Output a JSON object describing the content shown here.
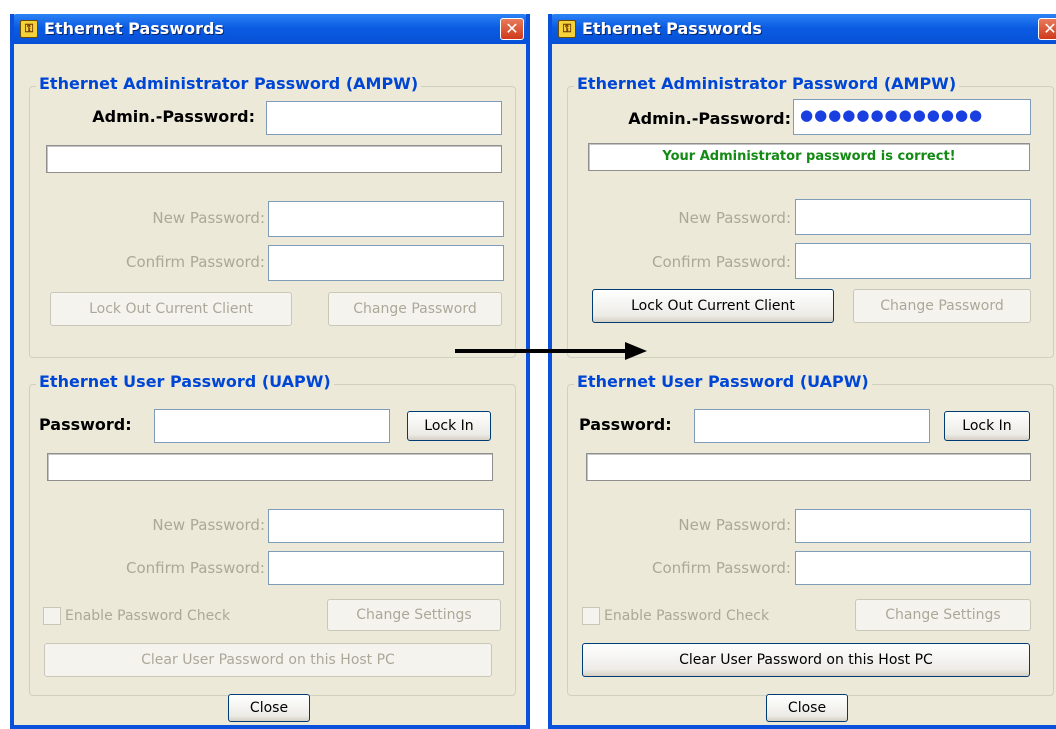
{
  "window": {
    "title": "Ethernet Passwords",
    "icon": "device-app-icon",
    "close_glyph": "✕"
  },
  "left": {
    "admin_group": {
      "title": "Ethernet Administrator Password (AMPW)",
      "admin_label": "Admin.-Password:",
      "admin_value": "",
      "status": "",
      "new_label": "New Password:",
      "confirm_label": "Confirm Password:",
      "lockout_button": "Lock Out Current Client",
      "change_button": "Change Password"
    },
    "user_group": {
      "title": "Ethernet User Password (UAPW)",
      "password_label": "Password:",
      "lockin_button": "Lock In",
      "status": "",
      "new_label": "New Password:",
      "confirm_label": "Confirm Password:",
      "enable_check_label": "Enable Password Check",
      "change_settings_button": "Change Settings",
      "clear_button": "Clear User Password on this Host PC"
    },
    "close_button": "Close"
  },
  "right": {
    "admin_group": {
      "title": "Ethernet Administrator Password (AMPW)",
      "admin_label": "Admin.-Password:",
      "admin_value": "●●●●●●●●●●●●●",
      "status": "Your Administrator password is correct!",
      "new_label": "New Password:",
      "confirm_label": "Confirm Password:",
      "lockout_button": "Lock Out Current Client",
      "change_button": "Change Password"
    },
    "user_group": {
      "title": "Ethernet User Password (UAPW)",
      "password_label": "Password:",
      "lockin_button": "Lock In",
      "status": "",
      "new_label": "New Password:",
      "confirm_label": "Confirm Password:",
      "enable_check_label": "Enable Password Check",
      "change_settings_button": "Change Settings",
      "clear_button": "Clear User Password on this Host PC"
    },
    "close_button": "Close"
  },
  "colors": {
    "title_bar": "#0b5ce3",
    "group_title": "#0046d5",
    "status_ok": "#138a13",
    "disabled_text": "#aca899"
  }
}
